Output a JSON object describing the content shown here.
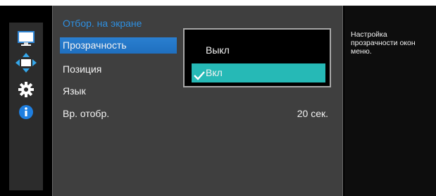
{
  "menu": {
    "title": "Отбор. на экране",
    "items": [
      {
        "label": "Прозрачность",
        "selected": true
      },
      {
        "label": "Позиция"
      },
      {
        "label": "Язык"
      },
      {
        "label": "Вр. отобр.",
        "value": "20 сек."
      }
    ]
  },
  "dropdown": {
    "options": [
      {
        "label": "Выкл",
        "checked": false
      },
      {
        "label": "Вкл",
        "checked": true
      }
    ]
  },
  "help": {
    "text": "Настройка прозрачности окон меню."
  },
  "sidebar": {
    "icons": [
      "monitor-icon",
      "move-arrows-icon",
      "gear-icon",
      "info-icon"
    ]
  },
  "colors": {
    "selected_item": "#1f6fbf",
    "selected_option": "#26b9b6",
    "title_text": "#2e8fe0"
  }
}
